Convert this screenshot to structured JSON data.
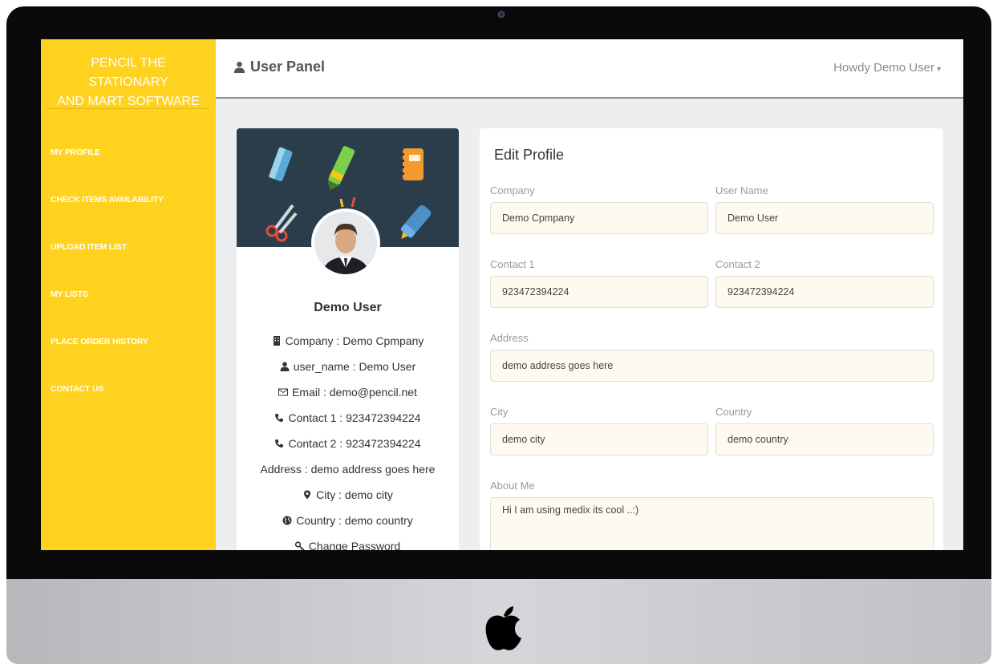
{
  "brand": {
    "line1": "PENCIL THE STATIONARY",
    "line2": "AND MART SOFTWARE"
  },
  "sidebar": {
    "items": [
      {
        "label": "MY PROFILE"
      },
      {
        "label": "CHECK ITEMS AVAILABILITY"
      },
      {
        "label": "UPLOAD ITEM LIST"
      },
      {
        "label": "MY LISTS"
      },
      {
        "label": "PLACE ORDER HISTORY"
      },
      {
        "label": "CONTACT US"
      }
    ]
  },
  "topbar": {
    "title": "User Panel",
    "user_menu": "Howdy Demo User"
  },
  "profile": {
    "name": "Demo User",
    "company": "Company : Demo Cpmpany",
    "user_name": "user_name : Demo User",
    "email": "Email : demo@pencil.net",
    "contact1": "Contact 1 : 923472394224",
    "contact2": "Contact 2 : 923472394224",
    "address": "Address : demo address goes here",
    "city": "City : demo city",
    "country": "Country : demo country",
    "change_password": "Change Password"
  },
  "edit": {
    "title": "Edit Profile",
    "company": {
      "label": "Company",
      "value": "Demo Cpmpany"
    },
    "username": {
      "label": "User Name",
      "value": "Demo User"
    },
    "contact1": {
      "label": "Contact 1",
      "value": "923472394224"
    },
    "contact2": {
      "label": "Contact 2",
      "value": "923472394224"
    },
    "address": {
      "label": "Address",
      "value": "demo address goes here"
    },
    "city": {
      "label": "City",
      "value": "demo city"
    },
    "country": {
      "label": "Country",
      "value": "demo country"
    },
    "about": {
      "label": "About Me",
      "value": "Hi I am using medix its cool ..:)"
    }
  },
  "colors": {
    "sidebar": "#ffd21f",
    "cover": "#2b3d4b",
    "input_bg": "#fffaf0"
  },
  "icons": [
    "user-icon",
    "caret-down-icon",
    "building-icon",
    "envelope-icon",
    "phone-icon",
    "map-marker-icon",
    "globe-icon",
    "key-icon",
    "apple-logo-icon"
  ]
}
